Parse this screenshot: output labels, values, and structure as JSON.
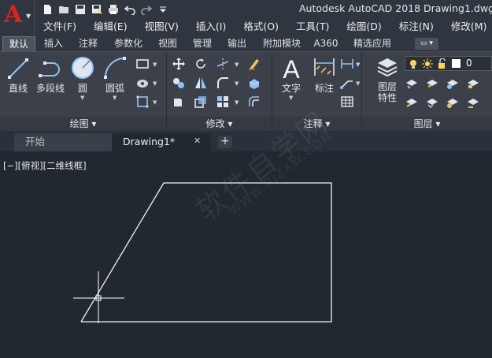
{
  "app": {
    "title": "Autodesk AutoCAD 2018",
    "document": "Drawing1.dwg",
    "logo_letter": "A"
  },
  "quick_access": [
    "new-icon",
    "open-icon",
    "save-icon",
    "saveas-icon",
    "print-icon",
    "undo-icon",
    "redo-icon",
    "customize-icon"
  ],
  "menu": [
    "文件(F)",
    "编辑(E)",
    "视图(V)",
    "插入(I)",
    "格式(O)",
    "工具(T)",
    "绘图(D)",
    "标注(N)",
    "修改(M)"
  ],
  "ribbon_tabs": {
    "items": [
      "默认",
      "插入",
      "注释",
      "参数化",
      "视图",
      "管理",
      "输出",
      "附加模块",
      "A360",
      "精选应用"
    ],
    "active": "默认",
    "extra": "▭ ▾"
  },
  "panels": {
    "draw": {
      "title": "绘图 ▾",
      "tools": [
        "直线",
        "多段线",
        "圆",
        "圆弧"
      ]
    },
    "modify": {
      "title": "修改 ▾"
    },
    "annotation": {
      "title": "注释 ▾",
      "tools": [
        "文字",
        "标注"
      ]
    },
    "layers": {
      "title": "图层 ▾",
      "tools": [
        "图层",
        "特性"
      ],
      "current_layer": "0"
    }
  },
  "file_tabs": {
    "start": "开始",
    "drawing": "Drawing1*",
    "close": "✕",
    "add": "+"
  },
  "viewport": {
    "controls": "[−][俯视][二维线框]",
    "watermark": "软件自学网",
    "watermark_url": "WWW.RJZXW.COM"
  },
  "colors": {
    "accent_red": "#e02222",
    "canvas": "#212830",
    "ribbon": "#3b4049"
  }
}
